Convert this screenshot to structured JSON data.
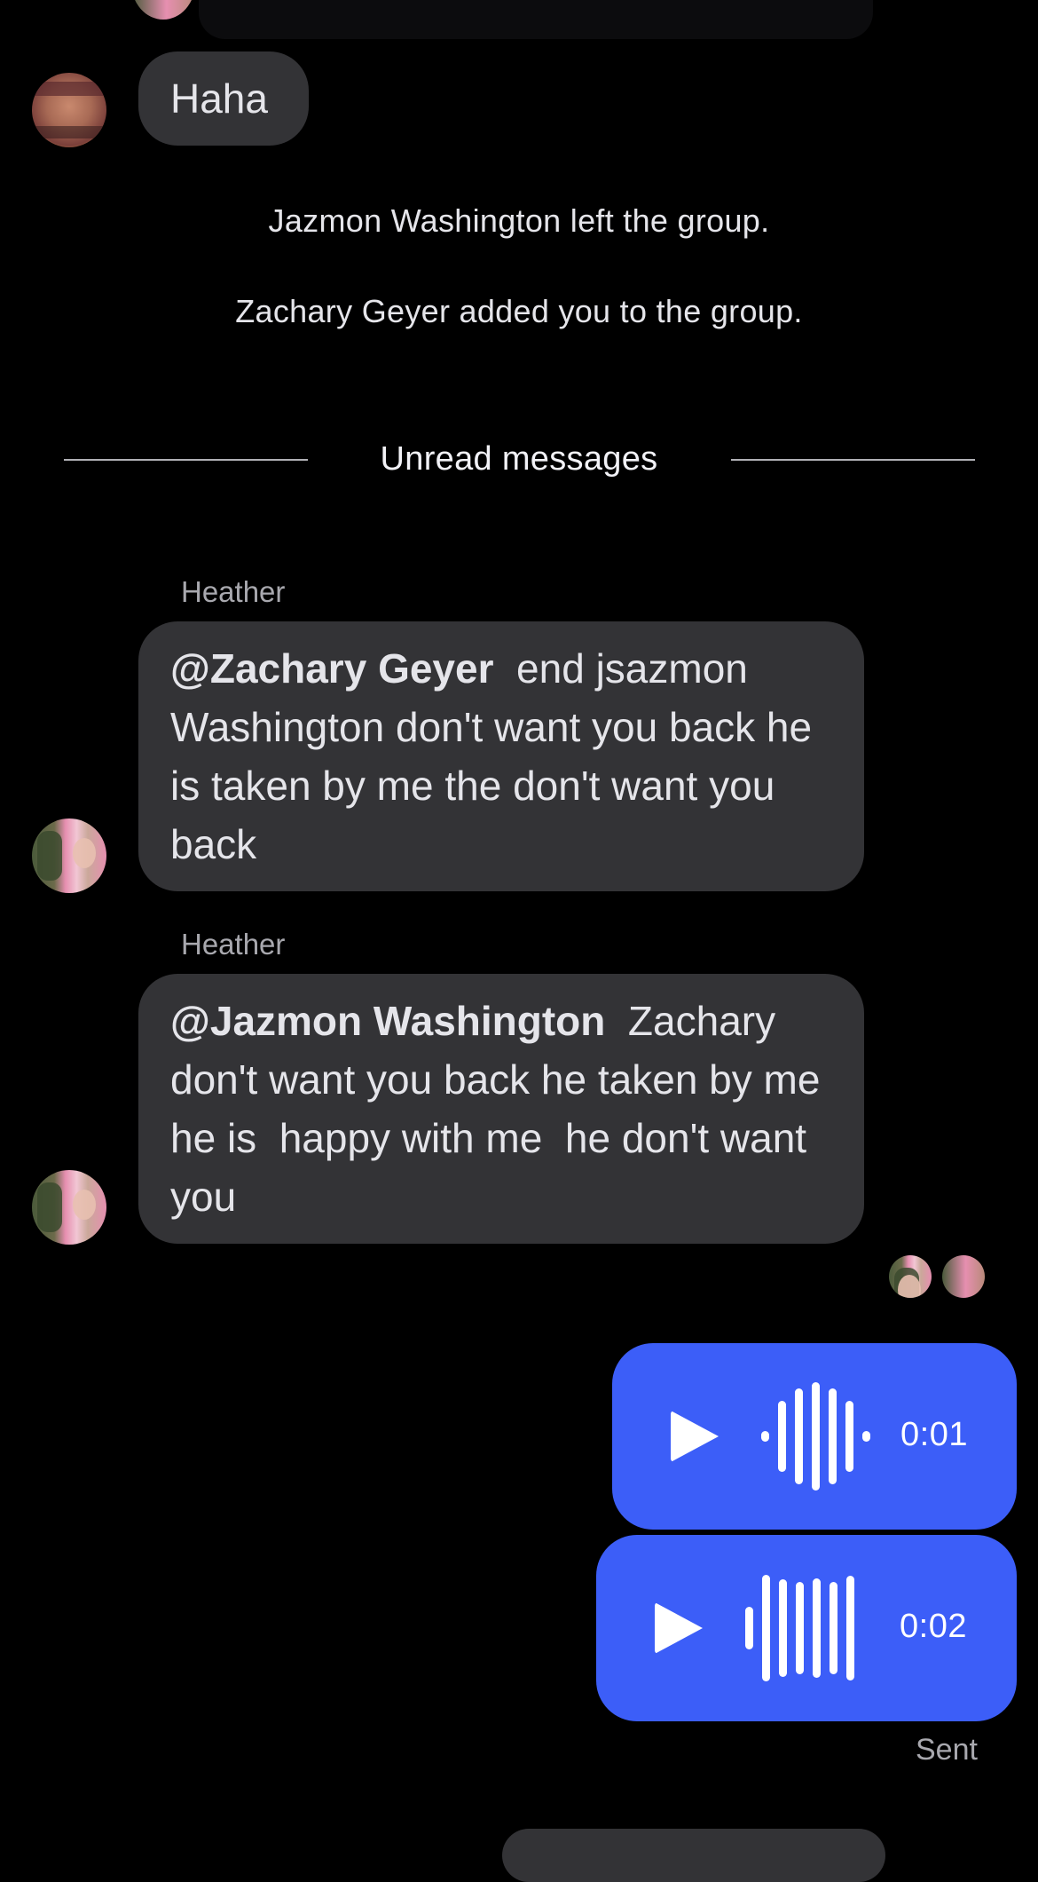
{
  "conversation": {
    "haha_message": "Haha",
    "system_messages": [
      "Jazmon Washington left the group.",
      "Zachary Geyer added you to the group."
    ],
    "unread_divider": "Unread messages",
    "messages": [
      {
        "sender": "Heather",
        "mention": "@Zachary Geyer",
        "text": "  end jsazmon Washington don't want you back he is taken by me the don't want you back"
      },
      {
        "sender": "Heather",
        "mention": "@Jazmon Washington",
        "text": "  Zachary don't want you back he taken by me he is  happy with me  he don't want you"
      }
    ],
    "voice_messages": [
      {
        "duration": "0:01"
      },
      {
        "duration": "0:02"
      }
    ],
    "delivery_status": "Sent"
  },
  "colors": {
    "background": "#000000",
    "incoming_bubble": "#333336",
    "outgoing_bubble": "#3C5EF8",
    "text": "#E5E5EA"
  }
}
